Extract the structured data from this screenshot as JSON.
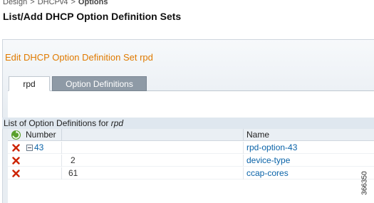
{
  "breadcrumb": {
    "items": [
      "Design",
      "DHCPv4"
    ],
    "separator": ">",
    "current": "Options"
  },
  "page_title": "List/Add DHCP Option Definition Sets",
  "panel": {
    "title": "Edit DHCP Option Definition Set rpd"
  },
  "tabs": [
    {
      "label": "rpd",
      "active": false
    },
    {
      "label": "Option Definitions",
      "active": true
    }
  ],
  "list": {
    "caption_prefix": "List of Option Definitions for ",
    "caption_set": "rpd",
    "columns": {
      "number": "Number",
      "name": "Name"
    },
    "rows": [
      {
        "number": "43",
        "name": "rpd-option-43",
        "expandable": true
      },
      {
        "number": "2",
        "name": "device-type",
        "expandable": false
      },
      {
        "number": "61",
        "name": "ccap-cores",
        "expandable": false
      }
    ]
  },
  "figure_id": "366350",
  "icons": {
    "refresh": "refresh-icon",
    "delete": "delete-x-icon",
    "expand": "expand-minus-icon"
  },
  "colors": {
    "panel_title": "#e07a00",
    "link": "#0a63a8",
    "active_tab": "#8e9aa6",
    "delete": "#cc2200"
  }
}
